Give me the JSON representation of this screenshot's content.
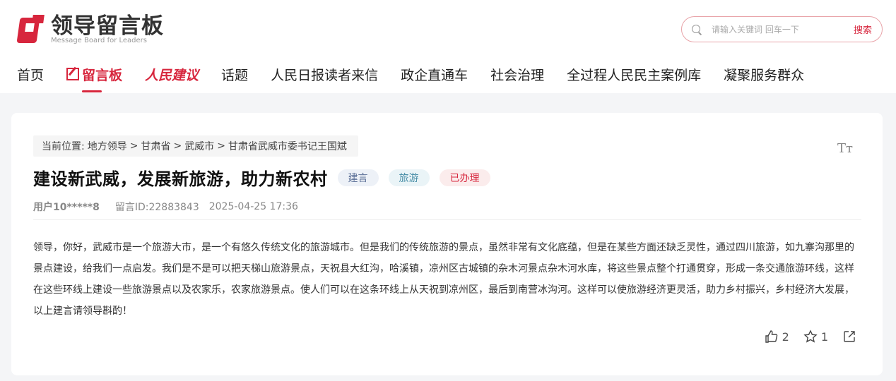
{
  "logo": {
    "title": "领导留言板",
    "subtitle": "Message Board for Leaders"
  },
  "search": {
    "placeholder": "请输入关键词 回车一下",
    "button_label": "搜索"
  },
  "nav": {
    "items": [
      "首页",
      "留言板",
      "人民建议",
      "话题",
      "人民日报读者来信",
      "政企直通车",
      "社会治理",
      "全过程人民民主案例库",
      "凝聚服务群众"
    ]
  },
  "breadcrumb": {
    "prefix": "当前位置:",
    "path": [
      "地方领导",
      "甘肃省",
      "武威市",
      "甘肃省武威市委书记王国斌"
    ],
    "separator": ">"
  },
  "font_toggle": "Tт",
  "post": {
    "title": "建设新武威，发展新旅游，助力新农村",
    "tags": [
      "建言",
      "旅游",
      "已办理"
    ],
    "user": "用户10*****8",
    "message_id": "留言ID:22883843",
    "datetime": "2025-04-25 17:36",
    "body": "领导，你好，武威市是一个旅游大市，是一个有悠久传统文化的旅游城市。但是我们的传统旅游的景点，虽然非常有文化底蕴，但是在某些方面还缺乏灵性，通过四川旅游，如九寨沟那里的景点建设，给我们一点启发。我们是不是可以把天梯山旅游景点，天祝县大红沟，哈溪镇，凉州区古城镇的杂木河景点杂木河水库，将这些景点整个打通贯穿，形成一条交通旅游环线，这样在这些环线上建设一些旅游景点以及农家乐，农家旅游景点。使人们可以在这条环线上从天祝到凉州区，最后到南营冰沟河。这样可以使旅游经济更灵活，助力乡村振兴，乡村经济大发展，以上建言请领导斟酌！",
    "likes": "2",
    "favorites": "1"
  },
  "colors": {
    "accent": "#d7263d",
    "background": "#f4f5f7"
  }
}
